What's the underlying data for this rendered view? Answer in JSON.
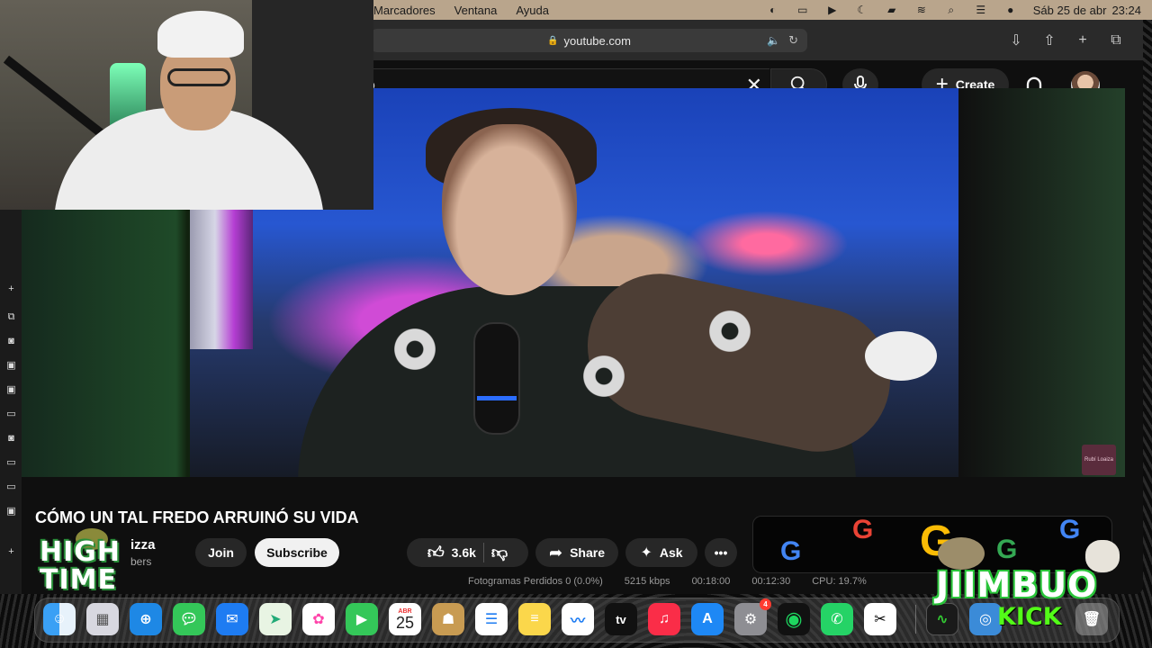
{
  "menubar": {
    "menus": [
      "Marcadores",
      "Ventana",
      "Ayuda"
    ],
    "clock_date": "Sáb 25 de abr",
    "clock_time": "23:24",
    "status_icons": [
      "screen-mirroring-icon",
      "window-icon",
      "play-icon",
      "moon-icon",
      "battery-icon",
      "wifi-icon",
      "search-icon",
      "control-center-icon",
      "siri-icon"
    ]
  },
  "browser": {
    "url": "youtube.com"
  },
  "youtube": {
    "search_value": "o",
    "create_label": "Create"
  },
  "video": {
    "title": "CÓMO UN TAL FREDO ARRUINÓ SU VIDA",
    "watermark": "Rubí Loaiza",
    "channel_name": "izza",
    "channel_subs": "bers",
    "join_label": "Join",
    "subscribe_label": "Subscribe",
    "likes": "3.6k",
    "share_label": "Share",
    "ask_label": "Ask"
  },
  "obs_stats": {
    "dropped": "Fotogramas Perdidos 0 (0.0%)",
    "bitrate": "5215 kbps",
    "rec_time": "00:18:00",
    "stream_time": "00:12:30",
    "cpu": "CPU: 19.7%"
  },
  "dock": {
    "calendar_month": "ABR",
    "calendar_day": "25",
    "settings_badge": "4",
    "tv_label": "tv"
  },
  "overlays": {
    "hightime": "HIGH TIME",
    "jiimbuo": "JIIMBUO",
    "kick": "KICK"
  },
  "colors": {
    "menubar": "#b9a58c",
    "youtube_bg": "#0f0f0f",
    "kick_green": "#53fc18"
  }
}
